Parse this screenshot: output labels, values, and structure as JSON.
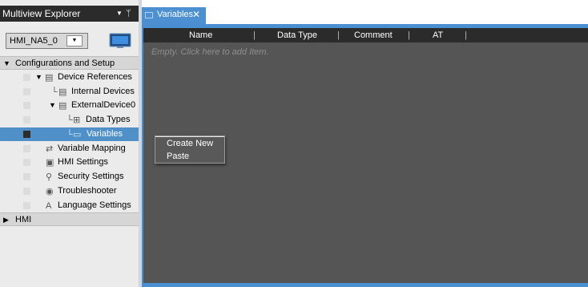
{
  "explorer": {
    "title": "Multiview Explorer",
    "dropdown_glyph": "▼",
    "pin_glyph": "ᛘ",
    "device_select_value": "HMI_NA5_0",
    "device_select_arrow": "▼"
  },
  "tree": {
    "configurations": "Configurations and Setup",
    "device_references": "Device References",
    "internal_devices": "Internal Devices",
    "external_device": "ExternalDevice0",
    "data_types": "Data Types",
    "variables": "Variables",
    "variable_mapping": "Variable Mapping",
    "hmi_settings": "HMI Settings",
    "security_settings": "Security Settings",
    "troubleshooter": "Troubleshooter",
    "language_settings": "Language Settings",
    "hmi": "HMI"
  },
  "tab": {
    "label": "Variables",
    "close_glyph": "✕"
  },
  "grid": {
    "columns": [
      "Name",
      "Data Type",
      "Comment",
      "AT"
    ],
    "separator": "|",
    "empty_hint": "Empty. Click here to add Item."
  },
  "context_menu": {
    "create_new": "Create New",
    "paste": "Paste"
  },
  "colors": {
    "accent": "#4d90d2",
    "selection": "#4f90c9",
    "header_dark": "#2b2b2b",
    "grid_bg": "#555555"
  }
}
